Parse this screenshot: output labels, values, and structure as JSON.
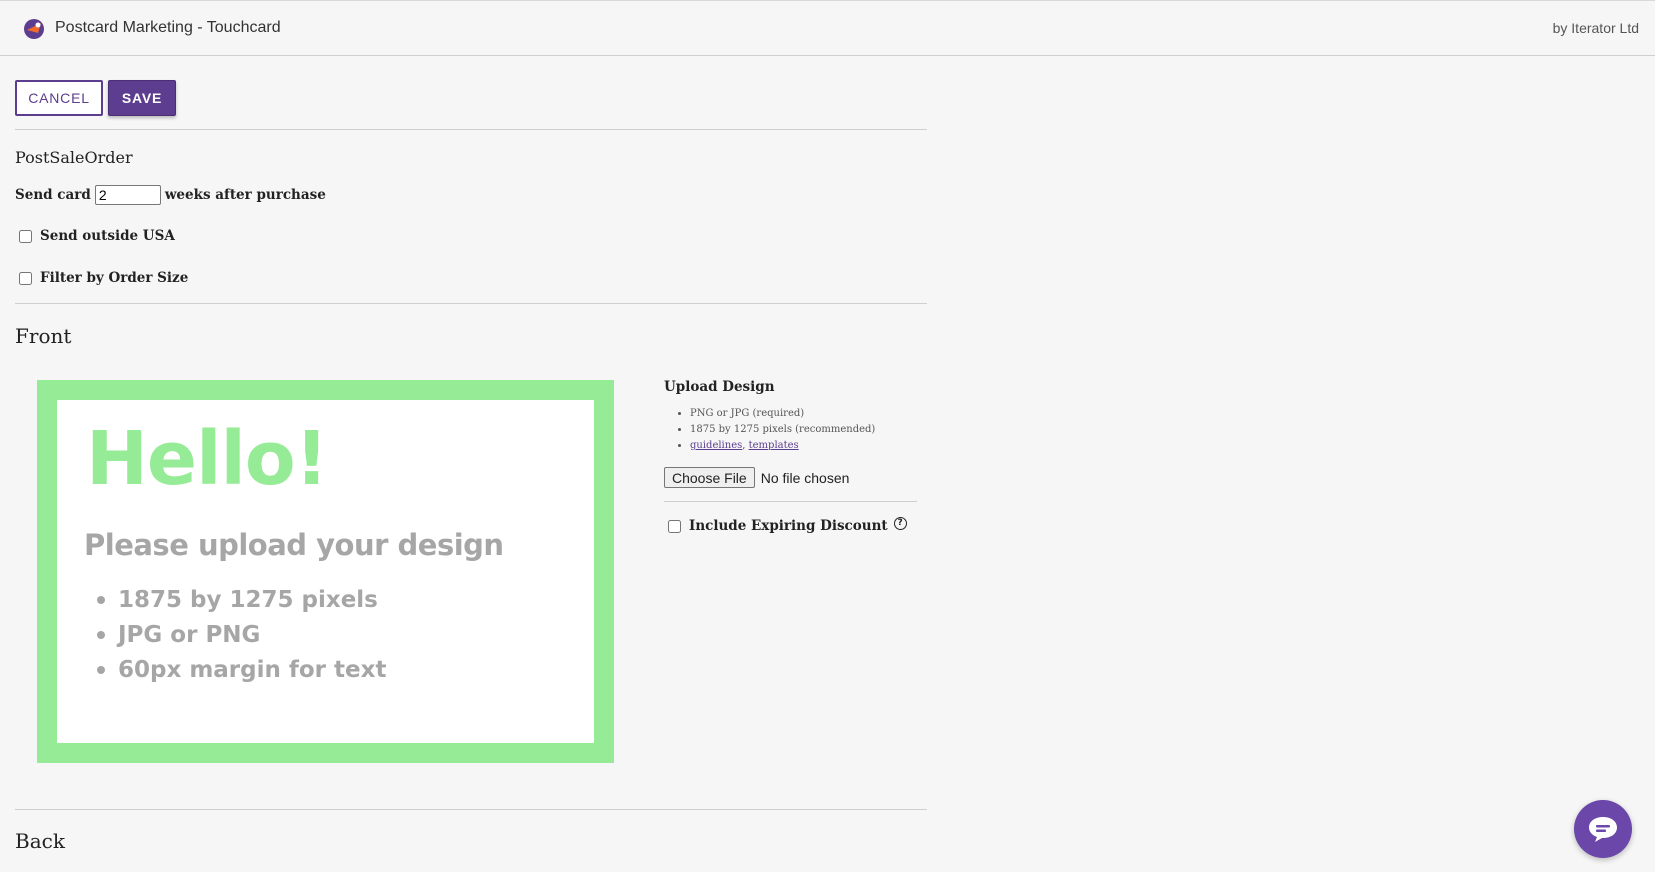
{
  "header": {
    "title": "Postcard Marketing - Touchcard",
    "by_line": "by Iterator Ltd"
  },
  "toolbar": {
    "cancel_label": "CANCEL",
    "save_label": "SAVE"
  },
  "form": {
    "name": "PostSaleOrder",
    "send_prefix": "Send card",
    "weeks_value": "2",
    "send_suffix": "weeks after purchase",
    "send_outside_usa_label": "Send outside USA",
    "send_outside_usa_checked": false,
    "filter_order_size_label": "Filter by Order Size",
    "filter_order_size_checked": false
  },
  "front": {
    "heading": "Front",
    "card": {
      "hello": "Hello!",
      "subtitle": "Please upload your design",
      "items": [
        "1875 by 1275 pixels",
        "JPG or PNG",
        "60px margin for text"
      ]
    },
    "upload": {
      "title": "Upload Design",
      "req_1": "PNG or JPG (required)",
      "req_2": "1875 by 1275 pixels (recommended)",
      "link_guidelines": "guidelines",
      "link_sep": ",",
      "link_templates": "templates",
      "choose_file_label": "Choose File",
      "no_file_text": "No file chosen"
    },
    "discount_label": "Include Expiring Discount",
    "discount_help_glyph": "?",
    "discount_checked": false
  },
  "back": {
    "heading": "Back"
  },
  "colors": {
    "accent": "#5c3d8f",
    "card_green": "#96eb96",
    "card_gray": "#a6a6a6",
    "chat": "#6a47a8"
  },
  "icons": {
    "logo": "touchcard-logo-icon",
    "chat": "chat-bubble-icon",
    "help": "question-circle-icon"
  }
}
